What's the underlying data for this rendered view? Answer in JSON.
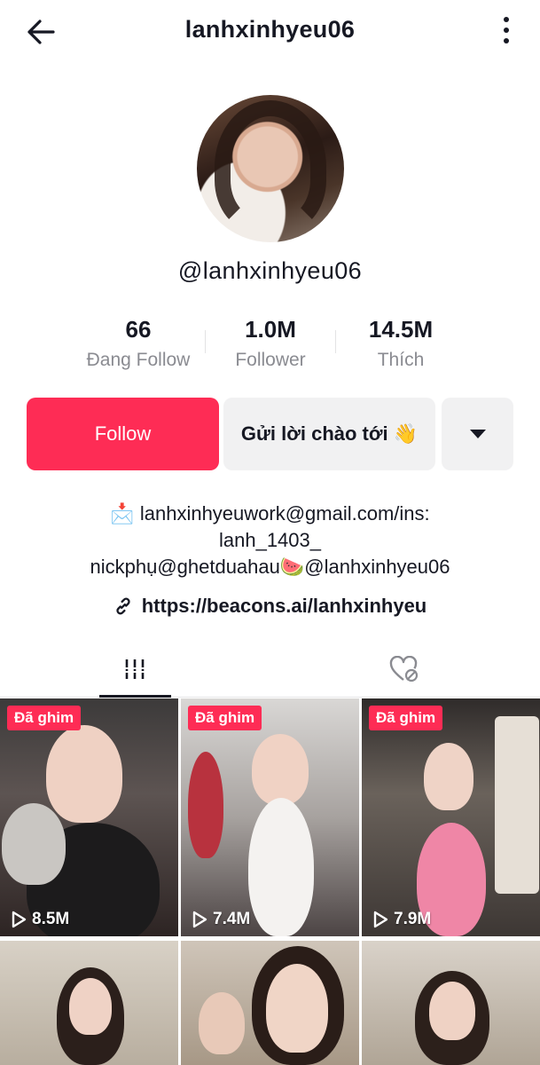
{
  "header": {
    "title": "lanhxinhyeu06",
    "back_icon": "arrow-left-icon",
    "more_icon": "more-vertical-icon"
  },
  "profile": {
    "username": "@lanhxinhyeu06"
  },
  "stats": [
    {
      "value": "66",
      "label": "Đang Follow"
    },
    {
      "value": "1.0M",
      "label": "Follower"
    },
    {
      "value": "14.5M",
      "label": "Thích"
    }
  ],
  "actions": {
    "follow": "Follow",
    "greet": "Gửi lời chào tới 👋",
    "dropdown_icon": "triangle-down-icon"
  },
  "bio": {
    "line1": "📩 lanhxinhyeuwork@gmail.com/ins:",
    "line2": "lanh_1403_",
    "line3": "nickphụ@ghetduahau🍉@lanhxinhyeu06",
    "link": "https://beacons.ai/lanhxinhyeu",
    "link_icon": "link-icon"
  },
  "tabs": [
    {
      "name": "videos",
      "icon": "grid-icon",
      "active": true
    },
    {
      "name": "liked",
      "icon": "heart-hidden-icon",
      "active": false
    }
  ],
  "videos": [
    {
      "pinned": true,
      "pin_label": "Đã ghim",
      "views": "8.5M"
    },
    {
      "pinned": true,
      "pin_label": "Đã ghim",
      "views": "7.4M"
    },
    {
      "pinned": true,
      "pin_label": "Đã ghim",
      "views": "7.9M"
    },
    {
      "pinned": false,
      "pin_label": "",
      "views": ""
    },
    {
      "pinned": false,
      "pin_label": "",
      "views": ""
    },
    {
      "pinned": false,
      "pin_label": "",
      "views": ""
    }
  ],
  "colors": {
    "accent": "#fe2c55",
    "text": "#161823",
    "muted": "#8a8b91",
    "button_bg": "#f1f1f2"
  }
}
